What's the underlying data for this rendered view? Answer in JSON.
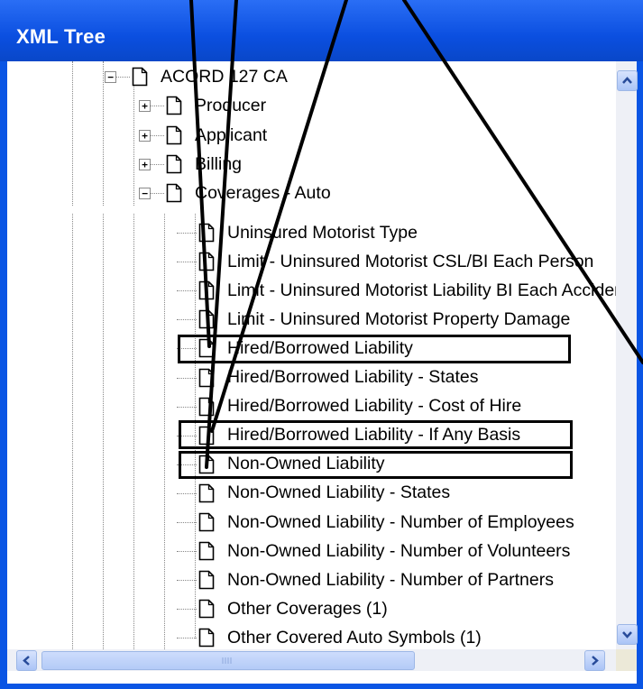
{
  "window": {
    "title": "XML Tree"
  },
  "tree": {
    "top_items": [
      {
        "label": "ACORD 127 CA",
        "expander": "−"
      },
      {
        "label": "Producer",
        "expander": "+"
      },
      {
        "label": "Applicant",
        "expander": "+"
      },
      {
        "label": "Billing",
        "expander": "+"
      },
      {
        "label": "Coverages - Auto",
        "expander": "−"
      }
    ],
    "coverage_items": [
      "Uninsured Motorist Type",
      "Limit - Uninsured Motorist CSL/BI Each Person",
      "Limit - Uninsured Motorist Liability BI Each Accident",
      "Limit - Uninsured Motorist Property Damage",
      "Hired/Borrowed Liability",
      "Hired/Borrowed Liability - States",
      "Hired/Borrowed Liability - Cost of Hire",
      "Hired/Borrowed Liability - If Any Basis",
      "Non-Owned Liability",
      "Non-Owned Liability - States",
      "Non-Owned Liability - Number of Employees",
      "Non-Owned Liability - Number of Volunteers",
      "Non-Owned Liability - Number of Partners",
      "Other Coverages (1)",
      "Other Covered Auto Symbols (1)"
    ]
  },
  "icons": {
    "document": "document-icon",
    "scroll_up": "arrow-up-icon",
    "scroll_down": "arrow-down-icon",
    "scroll_left": "arrow-left-icon",
    "scroll_right": "arrow-right-icon"
  },
  "colors": {
    "titlebar": "#0b4fe0",
    "scrollbar": "#eef0f6",
    "highlight_box": "#000000"
  },
  "annotations": {
    "highlighted_items": [
      "Hired/Borrowed Liability",
      "Hired/Borrowed Liability - If Any Basis",
      "Non-Owned Liability"
    ]
  }
}
